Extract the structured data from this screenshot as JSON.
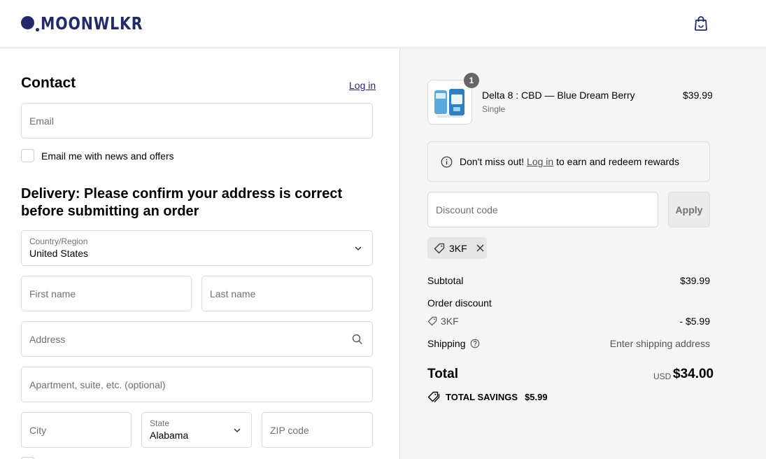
{
  "brand": {
    "name": "MOONWLKR"
  },
  "icons": {
    "cart": "shopping-bag-icon",
    "chevron": "chevron-down-icon",
    "search": "search-icon",
    "info": "info-icon",
    "tag": "tag-icon",
    "close": "close-icon",
    "help": "question-icon",
    "savings": "savings-tag-icon"
  },
  "colors": {
    "brand": "#232a6b",
    "summary_bg": "#f5f5f5"
  },
  "contact": {
    "title": "Contact",
    "login_label": "Log in",
    "email_placeholder": "Email",
    "newsletter_label": "Email me with news and offers"
  },
  "delivery": {
    "title": "Delivery: Please confirm your address is correct before submitting an order",
    "country_label": "Country/Region",
    "country_value": "United States",
    "first_name_placeholder": "First name",
    "last_name_placeholder": "Last name",
    "address_placeholder": "Address",
    "apartment_placeholder": "Apartment, suite, etc. (optional)",
    "city_placeholder": "City",
    "state_label": "State",
    "state_value": "Alabama",
    "zip_placeholder": "ZIP code"
  },
  "summary": {
    "product": {
      "quantity": "1",
      "name": "Delta 8 : CBD — Blue Dream Berry",
      "variant": "Single",
      "price": "$39.99"
    },
    "rewards": {
      "prefix": "Don't miss out!",
      "link": "Log in",
      "suffix": "to earn and redeem rewards"
    },
    "discount_placeholder": "Discount code",
    "apply_label": "Apply",
    "applied_code": "3KF",
    "subtotal_label": "Subtotal",
    "subtotal_value": "$39.99",
    "order_discount_label": "Order discount",
    "discount_code": "3KF",
    "discount_value": "- $5.99",
    "shipping_label": "Shipping",
    "shipping_value": "Enter shipping address",
    "total_label": "Total",
    "currency": "USD",
    "total_value": "$34.00",
    "savings_label": "TOTAL SAVINGS",
    "savings_value": "$5.99"
  }
}
